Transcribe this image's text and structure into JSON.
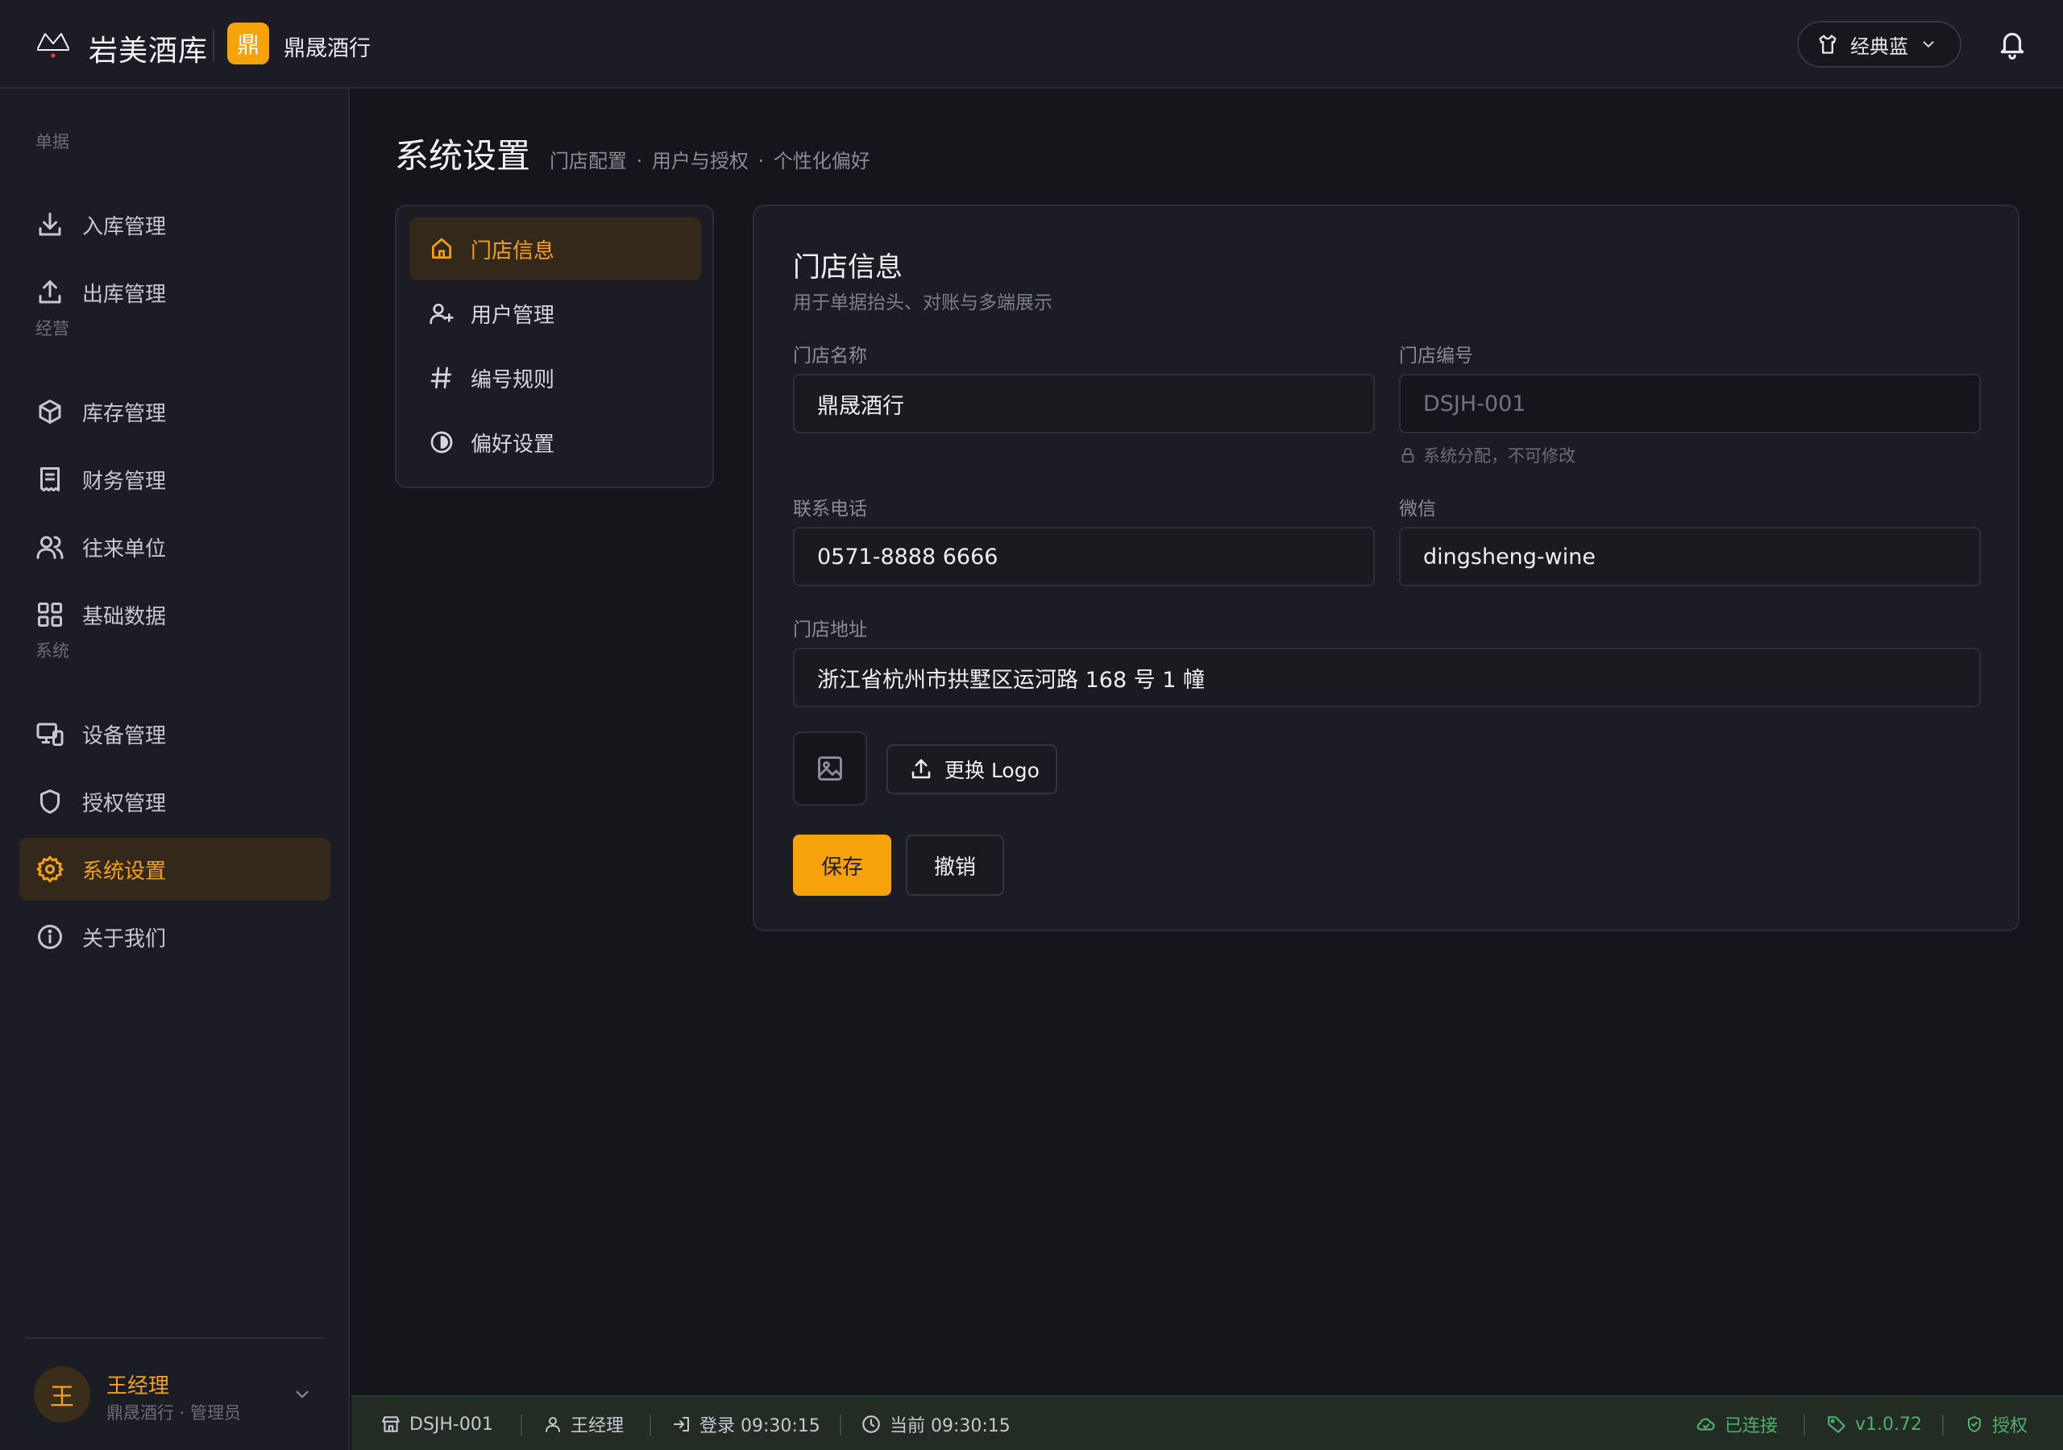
{
  "app": {
    "brand": "岩美酒库",
    "store_initial": "鼎",
    "store_name": "鼎晟酒行"
  },
  "header": {
    "theme_label": "经典蓝"
  },
  "sidebar": {
    "sections": [
      {
        "label": "单据"
      },
      {
        "label": "经营"
      },
      {
        "label": "系统"
      }
    ],
    "items": [
      {
        "label": "入库管理",
        "icon": "download-icon"
      },
      {
        "label": "出库管理",
        "icon": "upload-icon"
      },
      {
        "label": "库存管理",
        "icon": "box-icon"
      },
      {
        "label": "财务管理",
        "icon": "receipt-icon"
      },
      {
        "label": "往来单位",
        "icon": "users-icon"
      },
      {
        "label": "基础数据",
        "icon": "grid-icon"
      },
      {
        "label": "设备管理",
        "icon": "devices-icon"
      },
      {
        "label": "授权管理",
        "icon": "shield-icon"
      },
      {
        "label": "系统设置",
        "icon": "gear-icon",
        "active": true
      },
      {
        "label": "关于我们",
        "icon": "info-icon"
      }
    ],
    "user": {
      "avatar": "王",
      "name": "王经理",
      "sub": "鼎晟酒行 · 管理员"
    }
  },
  "page": {
    "title": "系统设置",
    "crumbs": "门店配置 · 用户与授权 · 个性化偏好"
  },
  "subnav": {
    "items": [
      {
        "label": "门店信息",
        "icon": "home-icon",
        "active": true
      },
      {
        "label": "用户管理",
        "icon": "user-plus-icon"
      },
      {
        "label": "编号规则",
        "icon": "hash-icon"
      },
      {
        "label": "偏好设置",
        "icon": "contrast-icon"
      }
    ]
  },
  "panel": {
    "title": "门店信息",
    "desc": "用于单据抬头、对账与多端展示",
    "fields": {
      "store_name": {
        "label": "门店名称",
        "value": "鼎晟酒行"
      },
      "store_code": {
        "label": "门店编号",
        "value": "DSJH-001",
        "hint": "系统分配，不可修改"
      },
      "phone": {
        "label": "联系电话",
        "value": "0571-8888 6666"
      },
      "wechat": {
        "label": "微信",
        "value": "dingsheng-wine"
      },
      "address": {
        "label": "门店地址",
        "value": "浙江省杭州市拱墅区运河路 168 号 1 幢"
      }
    },
    "upload_label": "更换 Logo",
    "save_label": "保存",
    "cancel_label": "撤销"
  },
  "statusbar": {
    "store_code": "DSJH-001",
    "user": "王经理",
    "login": "登录 09:30:15",
    "now": "当前 09:30:15",
    "connection": "已连接",
    "version": "v1.0.72",
    "license": "授权"
  },
  "colors": {
    "accent": "#f5a20b",
    "background": "#15161b",
    "surface": "#1c1d24",
    "status_green": "#4fb06a"
  }
}
